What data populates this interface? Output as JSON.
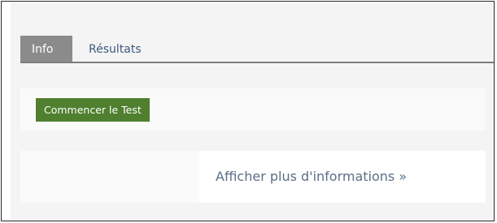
{
  "tabs": [
    {
      "label": "Info",
      "active": true
    },
    {
      "label": "Résultats",
      "active": false
    }
  ],
  "actions": {
    "start_test_label": "Commencer le Test"
  },
  "links": {
    "more_info_label": "Afficher plus d'informations »"
  },
  "colors": {
    "tab_active_bg": "#8b8b8b",
    "tab_text": "#3d5a7d",
    "button_bg": "#4f7f2f",
    "link_text": "#5b6f87",
    "panel_bg": "#fafafa",
    "page_bg": "#f4f4f4",
    "frame_border": "#2a2a2a"
  }
}
